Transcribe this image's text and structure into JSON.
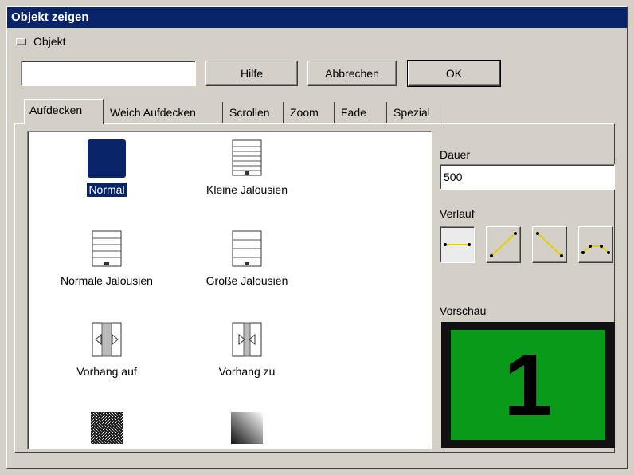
{
  "window": {
    "title": "Objekt zeigen"
  },
  "top": {
    "object_label": "Objekt",
    "object_input_value": "",
    "help_label": "Hilfe",
    "cancel_label": "Abbrechen",
    "ok_label": "OK"
  },
  "tabs": [
    {
      "label": "Aufdecken",
      "active": true
    },
    {
      "label": "Weich Aufdecken",
      "active": false
    },
    {
      "label": "Scrollen",
      "active": false
    },
    {
      "label": "Zoom",
      "active": false
    },
    {
      "label": "Fade",
      "active": false
    },
    {
      "label": "Spezial",
      "active": false
    }
  ],
  "effects": [
    {
      "label": "Normal",
      "icon": "solid-square-icon",
      "selected": true
    },
    {
      "label": "Kleine Jalousien",
      "icon": "blinds-small-icon",
      "selected": false
    },
    {
      "label": "Normale Jalousien",
      "icon": "blinds-normal-icon",
      "selected": false
    },
    {
      "label": "Große Jalousien",
      "icon": "blinds-large-icon",
      "selected": false
    },
    {
      "label": "Vorhang auf",
      "icon": "curtain-open-icon",
      "selected": false
    },
    {
      "label": "Vorhang zu",
      "icon": "curtain-close-icon",
      "selected": false
    },
    {
      "label": "",
      "icon": "noise-dissolve-icon",
      "selected": false
    },
    {
      "label": "",
      "icon": "gradient-dissolve-icon",
      "selected": false
    }
  ],
  "right": {
    "duration_label": "Dauer",
    "duration_value": "500",
    "curve_label": "Verlauf",
    "curve_options": [
      "linear-flat-icon",
      "ease-rise-icon",
      "ease-fall-icon",
      "curve-arc-icon"
    ],
    "preview_label": "Vorschau",
    "preview_number": "1"
  },
  "colors": {
    "title_bar": "#0a246a",
    "selection": "#0a246a",
    "preview_bg": "#0a9a1a",
    "curve_line": "#e0d000"
  }
}
